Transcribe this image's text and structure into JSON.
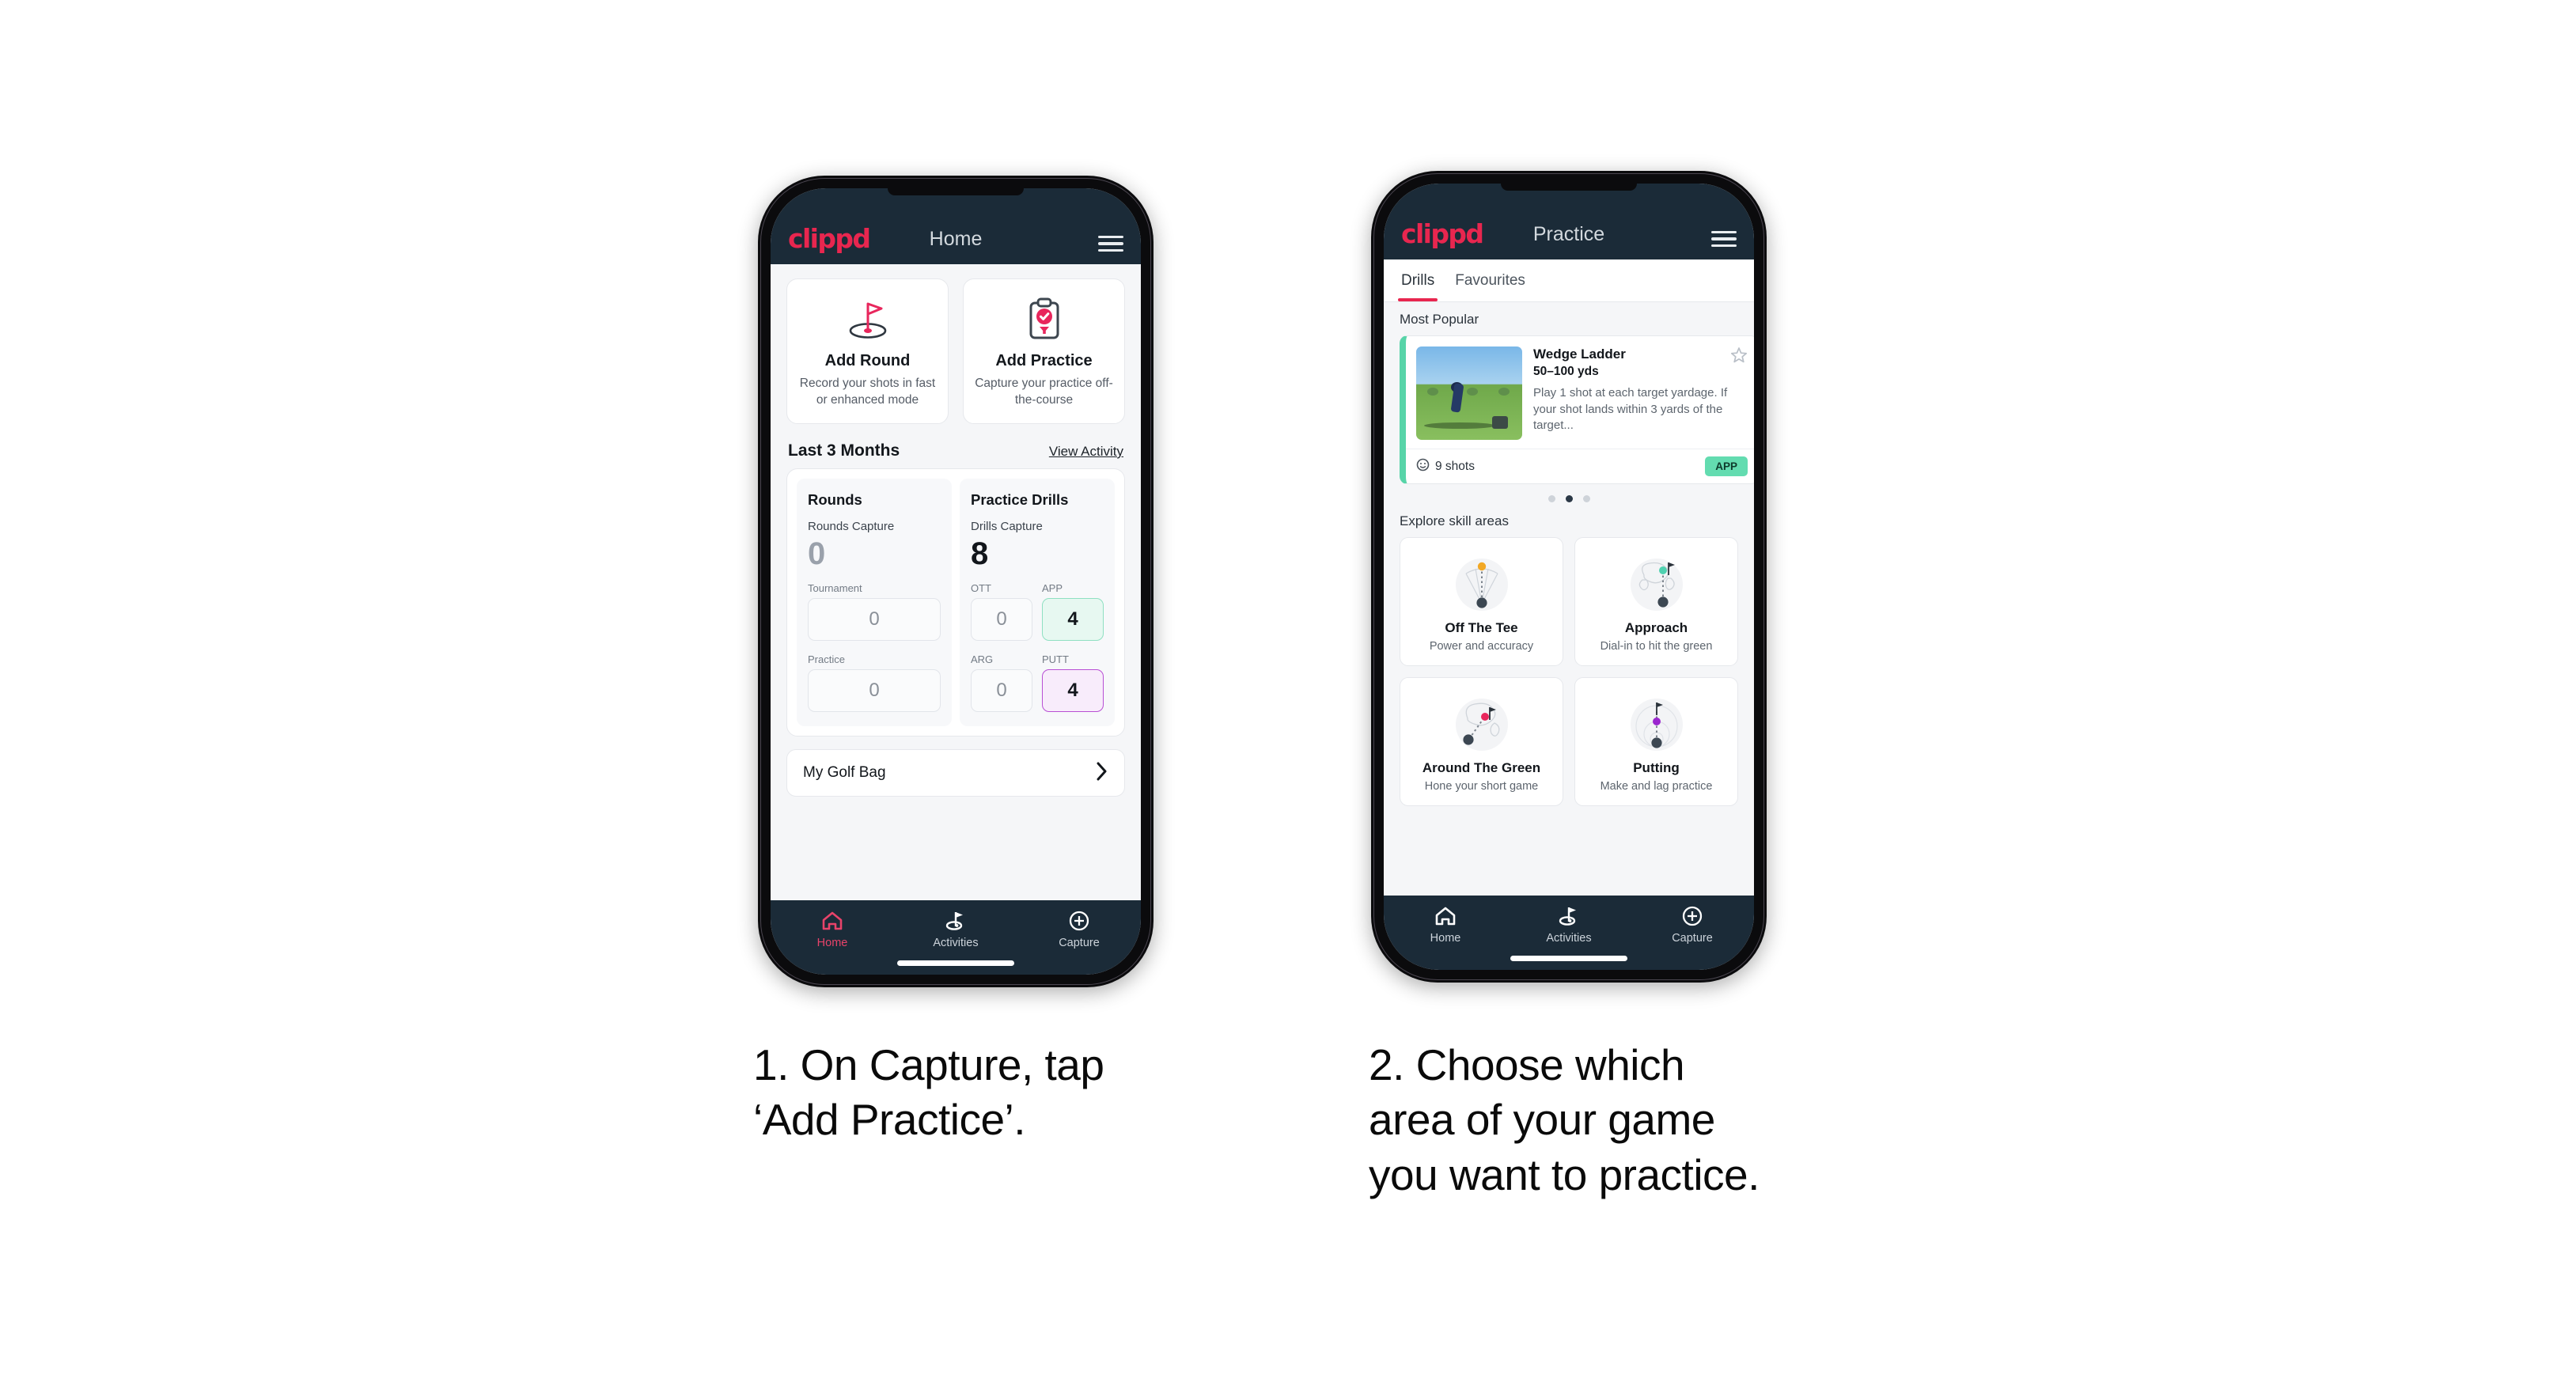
{
  "phones": [
    {
      "appbar": {
        "logo": "clippd",
        "title": "Home",
        "menu_icon": "hamburger-icon"
      },
      "actions": [
        {
          "icon": "golf-flag-hole-icon",
          "title": "Add Round",
          "sub": "Record your shots in fast or enhanced mode"
        },
        {
          "icon": "clipboard-check-tee-icon",
          "title": "Add Practice",
          "sub": "Capture your practice off-the-course"
        }
      ],
      "section": {
        "title": "Last 3 Months",
        "link": "View Activity"
      },
      "stats": {
        "rounds": {
          "header": "Rounds",
          "capture_label": "Rounds Capture",
          "capture_value": "0",
          "fields": [
            {
              "label": "Tournament",
              "value": "0",
              "style": "plain"
            },
            {
              "label": "Practice",
              "value": "0",
              "style": "plain"
            }
          ]
        },
        "drills": {
          "header": "Practice Drills",
          "capture_label": "Drills Capture",
          "capture_value": "8",
          "fields": [
            {
              "label": "OTT",
              "value": "0",
              "style": "plain"
            },
            {
              "label": "APP",
              "value": "4",
              "style": "app"
            },
            {
              "label": "ARG",
              "value": "0",
              "style": "plain"
            },
            {
              "label": "PUTT",
              "value": "4",
              "style": "putt"
            }
          ]
        }
      },
      "bag": {
        "label": "My Golf Bag",
        "chevron": "chevron-right-icon"
      },
      "nav": [
        {
          "icon": "home-icon",
          "label": "Home",
          "active": true
        },
        {
          "icon": "golf-flag-icon",
          "label": "Activities",
          "active": false
        },
        {
          "icon": "plus-circle-icon",
          "label": "Capture",
          "active": false
        }
      ]
    },
    {
      "appbar": {
        "logo": "clippd",
        "title": "Practice",
        "menu_icon": "hamburger-icon"
      },
      "tabs": [
        {
          "label": "Drills",
          "active": true
        },
        {
          "label": "Favourites",
          "active": false
        }
      ],
      "most_popular_label": "Most Popular",
      "drill": {
        "title": "Wedge Ladder",
        "yards": "50–100 yds",
        "desc": "Play 1 shot at each target yardage. If your shot lands within 3 yards of the target...",
        "shots": "9 shots",
        "badge": "APP",
        "star_icon": "star-outline-icon",
        "clock_icon": "clock-icon",
        "accent": "#57d4a8"
      },
      "carousel_dots": {
        "count": 3,
        "active_index": 1
      },
      "skills_label": "Explore skill areas",
      "skills": [
        {
          "icon": "off-the-tee-icon",
          "title": "Off The Tee",
          "sub": "Power and accuracy",
          "dot": "#f2a825"
        },
        {
          "icon": "approach-icon",
          "title": "Approach",
          "sub": "Dial-in to hit the green",
          "dot": "#4fd1b0"
        },
        {
          "icon": "around-the-green-icon",
          "title": "Around The Green",
          "sub": "Hone your short game",
          "dot": "#e8265c"
        },
        {
          "icon": "putting-icon",
          "title": "Putting",
          "sub": "Make and lag practice",
          "dot": "#9b27cf"
        }
      ],
      "nav": [
        {
          "icon": "home-icon",
          "label": "Home",
          "active": false
        },
        {
          "icon": "golf-flag-icon",
          "label": "Activities",
          "active": false
        },
        {
          "icon": "plus-circle-icon",
          "label": "Capture",
          "active": false
        }
      ]
    }
  ],
  "captions": [
    {
      "line1": "1. On Capture, tap",
      "line2": "‘Add Practice’.",
      "line3": ""
    },
    {
      "line1": "2. Choose which",
      "line2": "area of your game",
      "line3": "you want to practice."
    }
  ],
  "colors": {
    "brand_red": "#e8264f",
    "appbar": "#1b2b38",
    "app_green": "#63dcb0",
    "putt_purple": "#b84fd4",
    "page_bg": "#ffffff"
  }
}
